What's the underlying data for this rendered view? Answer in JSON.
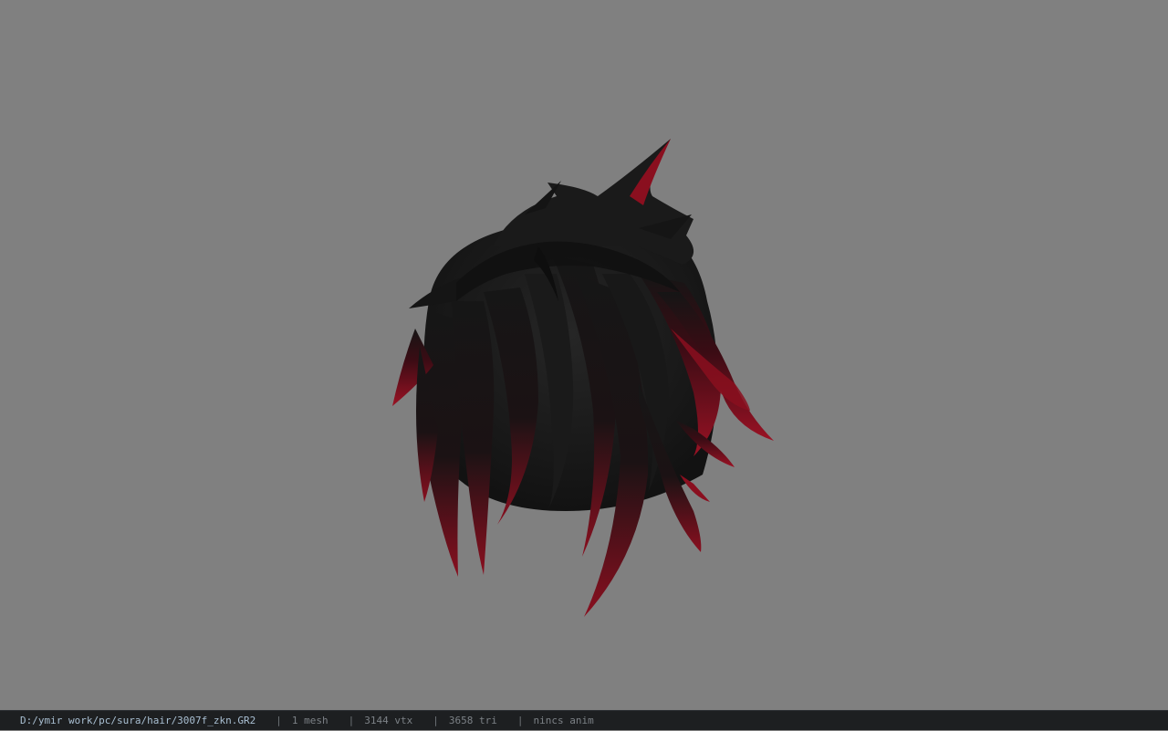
{
  "viewer": {
    "background_color": "#808080",
    "model": {
      "icon": "hair-model-icon",
      "base_color": "#141414",
      "tip_color": "#8a0f1f"
    }
  },
  "status_bar": {
    "file_path": "D:/ymir work/pc/sura/hair/3007f_zkn.GR2",
    "separator": "|",
    "mesh_count": "1 mesh",
    "vertex_count": "3144 vtx",
    "triangle_count": "3658 tri",
    "anim_status": "nincs anim"
  }
}
